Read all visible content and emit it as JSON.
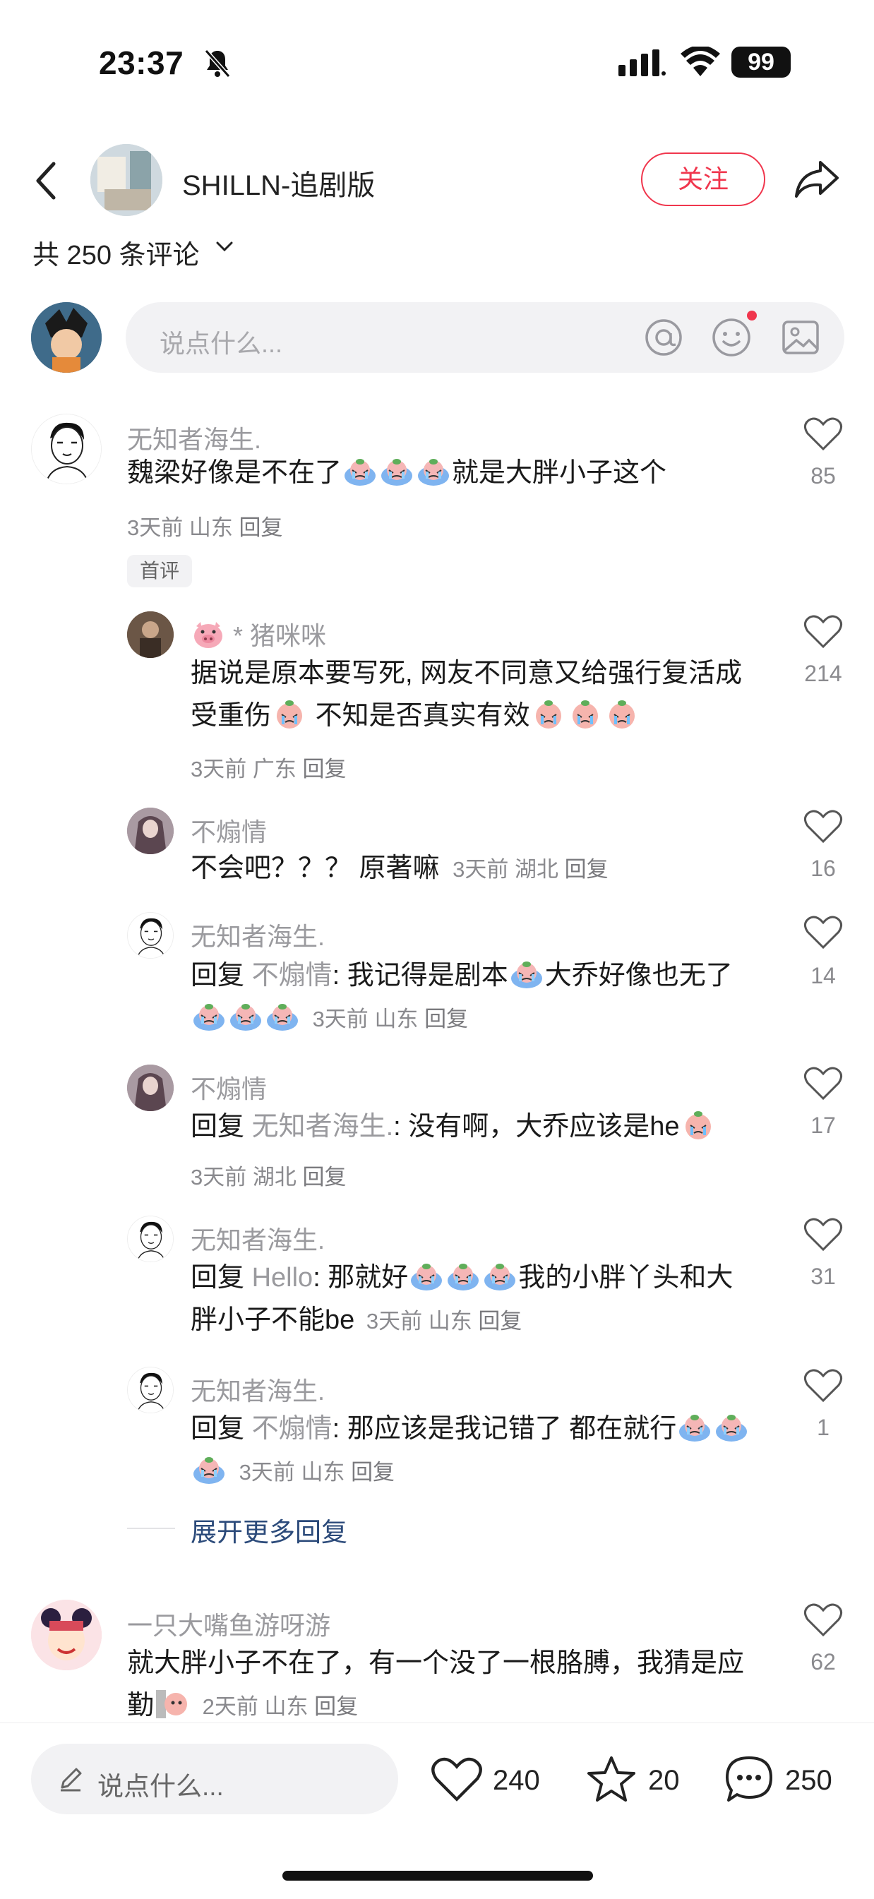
{
  "status_bar": {
    "time": "23:37",
    "battery": "99"
  },
  "header": {
    "title": "SHILLN-追剧版",
    "follow_label": "关注"
  },
  "comments_header": {
    "count_label": "共 250 条评论"
  },
  "composer": {
    "placeholder": "说点什么..."
  },
  "comments": [
    {
      "name": "无知者海生.",
      "text": "魏梁好像是不在了",
      "text_tail": "就是大胖小子这个",
      "time": "3天前",
      "location": "山东",
      "reply_label": "回复",
      "tag": "首评",
      "likes": "85"
    },
    {
      "name": "* 猪咪咪",
      "text_line1": "据说是原本要写死, 网友不同意又给强行复活成",
      "text_line2_a": "受重伤",
      "text_line2_b": " 不知是否真实有效",
      "time": "3天前",
      "location": "广东",
      "reply_label": "回复",
      "likes": "214"
    },
    {
      "name": "不煽情",
      "text": "不会吧？？？ 原著嘛",
      "time": "3天前",
      "location": "湖北",
      "reply_label": "回复",
      "likes": "16"
    },
    {
      "name": "无知者海生.",
      "reply_prefix": "回复",
      "reply_to": "不煽情",
      "text_a": ": 我记得是剧本",
      "text_b": "大乔好像也无了",
      "time": "3天前",
      "location": "山东",
      "reply_label": "回复",
      "likes": "14"
    },
    {
      "name": "不煽情",
      "reply_prefix": "回复",
      "reply_to": "无知者海生.",
      "text_a": ": 没有啊，大乔应该是he",
      "time": "3天前",
      "location": "湖北",
      "reply_label": "回复",
      "likes": "17"
    },
    {
      "name": "无知者海生.",
      "reply_prefix": "回复",
      "reply_to": "Hello",
      "text_a": ": 那就好",
      "text_b": "我的小胖丫头和大",
      "text_line2": "胖小子不能be",
      "time": "3天前",
      "location": "山东",
      "reply_label": "回复",
      "likes": "31"
    },
    {
      "name": "无知者海生.",
      "reply_prefix": "回复",
      "reply_to": "不煽情",
      "text_a": ": 那应该是我记错了 都在就行",
      "time": "3天前",
      "location": "山东",
      "reply_label": "回复",
      "likes": "1"
    },
    {
      "name": "一只大嘴鱼游呀游",
      "text_line1": "就大胖小子不在了，有一个没了一根胳膊，我猜是应",
      "text_line2": "勤",
      "time": "2天前",
      "location": "山东",
      "reply_label": "回复",
      "likes": "62"
    }
  ],
  "expand_label": "展开更多回复",
  "bottom_bar": {
    "placeholder": "说点什么...",
    "likes": "240",
    "favorites": "20",
    "comments": "250"
  },
  "colors": {
    "accent": "#f0364d",
    "link": "#2b4a7a"
  },
  "icons": [
    "back-icon",
    "share-icon",
    "at-icon",
    "emoji-icon",
    "image-icon",
    "heart-icon",
    "star-icon",
    "comment-icon",
    "pencil-icon",
    "bell-mute-icon",
    "signal-icon",
    "wifi-icon"
  ]
}
